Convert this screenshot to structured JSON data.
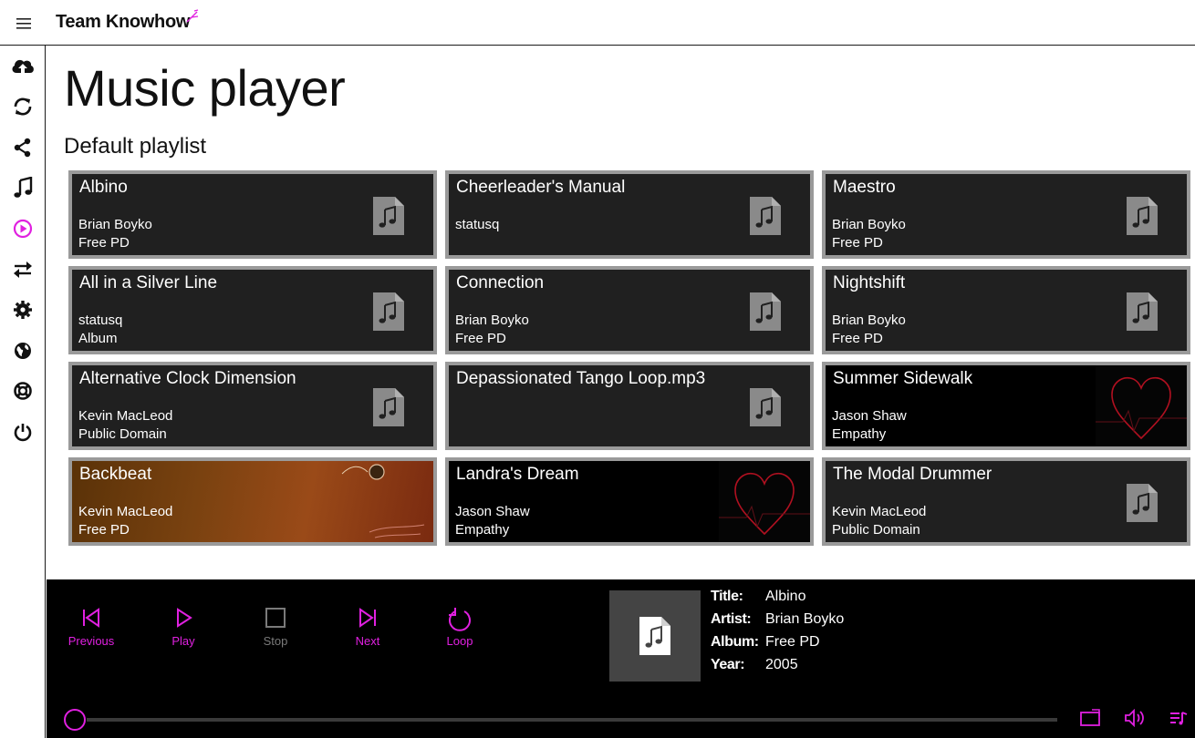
{
  "app": {
    "brand": "Team Knowhow",
    "accent": "#e020e0"
  },
  "sidebar": {
    "items": [
      {
        "icon": "cloud-upload-icon",
        "active": false
      },
      {
        "icon": "sync-icon",
        "active": false
      },
      {
        "icon": "share-icon",
        "active": false
      },
      {
        "icon": "music-note-icon",
        "active": false
      },
      {
        "icon": "play-circle-icon",
        "active": true
      },
      {
        "icon": "transfer-icon",
        "active": false
      },
      {
        "icon": "gear-icon",
        "active": false
      },
      {
        "icon": "globe-icon",
        "active": false
      },
      {
        "icon": "lifebuoy-icon",
        "active": false
      },
      {
        "icon": "power-icon",
        "active": false
      }
    ]
  },
  "main": {
    "title": "Music player",
    "playlist_title": "Default playlist",
    "tracks": [
      {
        "title": "Albino",
        "artist": "Brian Boyko",
        "album": "Free PD",
        "art": "note"
      },
      {
        "title": "Cheerleader's Manual",
        "artist": "statusq",
        "album": "",
        "art": "note"
      },
      {
        "title": "Maestro",
        "artist": "Brian Boyko",
        "album": "Free PD",
        "art": "note"
      },
      {
        "title": "All in a Silver Line",
        "artist": "statusq",
        "album": "Album",
        "art": "note"
      },
      {
        "title": "Connection",
        "artist": "Brian Boyko",
        "album": "Free PD",
        "art": "note"
      },
      {
        "title": "Nightshift",
        "artist": "Brian Boyko",
        "album": "Free PD",
        "art": "note"
      },
      {
        "title": "Alternative Clock Dimension",
        "artist": "Kevin MacLeod",
        "album": "Public Domain",
        "art": "note"
      },
      {
        "title": "Depassionated Tango Loop.mp3",
        "artist": "",
        "album": "",
        "art": "note"
      },
      {
        "title": "Summer Sidewalk",
        "artist": "Jason Shaw",
        "album": "Empathy",
        "art": "heart"
      },
      {
        "title": "Backbeat",
        "artist": "Kevin MacLeod",
        "album": "Free PD",
        "art": "backbeat"
      },
      {
        "title": "Landra's Dream",
        "artist": "Jason Shaw",
        "album": "Empathy",
        "art": "heart"
      },
      {
        "title": "The Modal Drummer",
        "artist": "Kevin MacLeod",
        "album": "Public Domain",
        "art": "note"
      }
    ]
  },
  "player": {
    "controls": {
      "previous": "Previous",
      "play": "Play",
      "stop": "Stop",
      "next": "Next",
      "loop": "Loop"
    },
    "now_playing": {
      "title_label": "Title:",
      "title": "Albino",
      "artist_label": "Artist:",
      "artist": "Brian Boyko",
      "album_label": "Album:",
      "album": "Free PD",
      "year_label": "Year:",
      "year": "2005"
    },
    "progress": 0
  }
}
